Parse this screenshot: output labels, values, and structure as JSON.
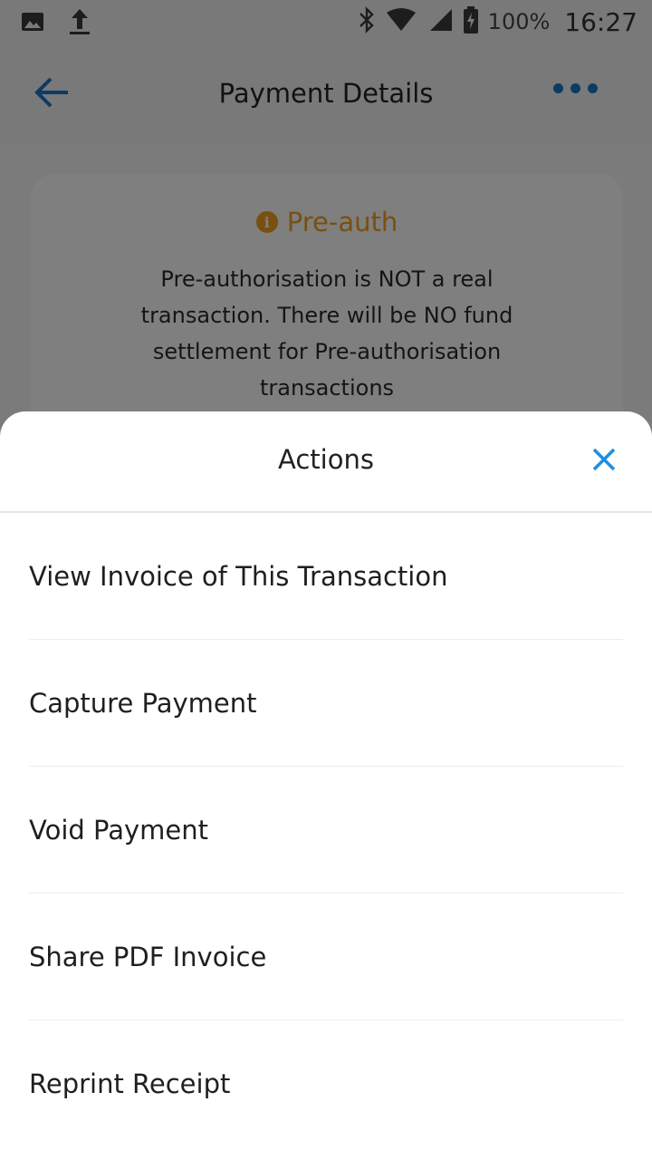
{
  "status_bar": {
    "battery_percent": "100%",
    "time": "16:27"
  },
  "app_bar": {
    "title": "Payment Details",
    "back_icon": "arrow-left-icon",
    "more_icon": "more-horizontal-icon"
  },
  "preauth_card": {
    "title": "Pre-auth",
    "message": "Pre-authorisation is NOT a real transaction. There will be NO fund settlement for Pre-authorisation transactions"
  },
  "actions_sheet": {
    "title": "Actions",
    "close_icon": "close-icon",
    "items": [
      {
        "label": "View Invoice of This Transaction"
      },
      {
        "label": "Capture Payment"
      },
      {
        "label": "Void Payment"
      },
      {
        "label": "Share PDF Invoice"
      },
      {
        "label": "Reprint Receipt"
      }
    ]
  },
  "colors": {
    "accent": "#1877c8",
    "warning": "#f0a020",
    "close": "#1a8fe0"
  }
}
